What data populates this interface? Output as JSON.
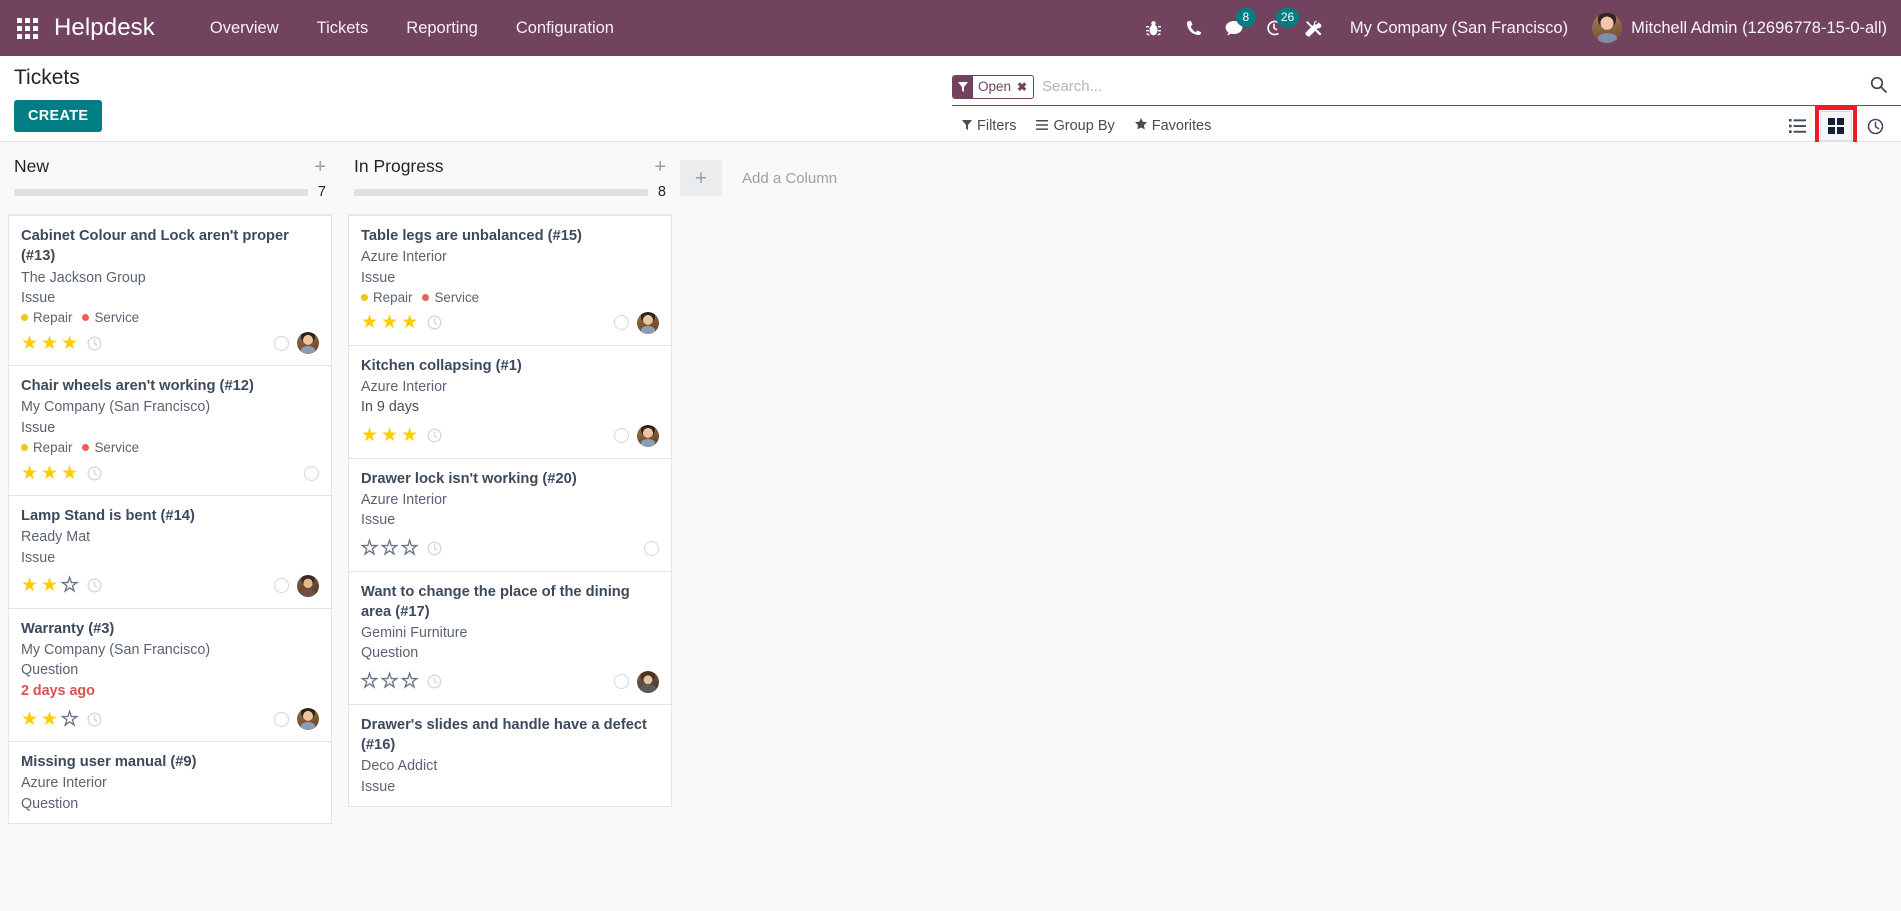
{
  "navbar": {
    "apps_icon": "apps-grid-icon",
    "brand": "Helpdesk",
    "menu": [
      {
        "label": "Overview"
      },
      {
        "label": "Tickets"
      },
      {
        "label": "Reporting"
      },
      {
        "label": "Configuration"
      }
    ],
    "sys_icons": [
      {
        "name": "bug-icon",
        "badge": ""
      },
      {
        "name": "phone-icon",
        "badge": ""
      },
      {
        "name": "messages-icon",
        "badge": "8"
      },
      {
        "name": "activities-clock-icon",
        "badge": "26"
      },
      {
        "name": "tools-icon",
        "badge": ""
      }
    ],
    "company": "My Company (San Francisco)",
    "user": "Mitchell Admin (12696778-15-0-all)"
  },
  "control_panel": {
    "page_title": "Tickets",
    "create_label": "CREATE",
    "search": {
      "facet_label": "Open",
      "facet_remove": "✖",
      "placeholder": "Search...",
      "value": ""
    },
    "filters_label": "Filters",
    "groupby_label": "Group By",
    "favorites_label": "Favorites",
    "views": [
      {
        "name": "list-view-button",
        "active": false
      },
      {
        "name": "kanban-view-button",
        "active": true
      },
      {
        "name": "activity-view-button",
        "active": false
      }
    ],
    "highlight_color": "#ed1c24"
  },
  "kanban": {
    "add_column_label": "Add a Column",
    "columns": [
      {
        "title": "New",
        "count": "7",
        "cards": [
          {
            "title": "Cabinet Colour and Lock aren't proper (#13)",
            "partner": "The Jackson Group",
            "type": "Issue",
            "date": "",
            "date_overdue": false,
            "tags": [
              {
                "label": "Repair",
                "color": "#f0c419"
              },
              {
                "label": "Service",
                "color": "#ee6055"
              }
            ],
            "stars": 3,
            "avatar": "av-mitchell"
          },
          {
            "title": "Chair wheels aren't working (#12)",
            "partner": "My Company (San Francisco)",
            "type": "Issue",
            "date": "",
            "date_overdue": false,
            "tags": [
              {
                "label": "Repair",
                "color": "#f0c419"
              },
              {
                "label": "Service",
                "color": "#ee6055"
              }
            ],
            "stars": 3,
            "avatar": ""
          },
          {
            "title": "Lamp Stand is bent (#14)",
            "partner": "Ready Mat",
            "type": "Issue",
            "date": "",
            "date_overdue": false,
            "tags": [],
            "stars": 2,
            "avatar": "av-marc"
          },
          {
            "title": "Warranty (#3)",
            "partner": "My Company (San Francisco)",
            "type": "Question",
            "date": "2 days ago",
            "date_overdue": true,
            "tags": [],
            "stars": 2,
            "avatar": "av-mitchell"
          },
          {
            "title": "Missing user manual (#9)",
            "partner": "Azure Interior",
            "type": "Question",
            "date": "",
            "date_overdue": false,
            "tags": [],
            "stars": 0,
            "avatar": ""
          }
        ]
      },
      {
        "title": "In Progress",
        "count": "8",
        "cards": [
          {
            "title": "Table legs are unbalanced (#15)",
            "partner": "Azure Interior",
            "type": "Issue",
            "date": "",
            "date_overdue": false,
            "tags": [
              {
                "label": "Repair",
                "color": "#f0c419"
              },
              {
                "label": "Service",
                "color": "#ee6055"
              }
            ],
            "stars": 3,
            "avatar": "av-mitchell"
          },
          {
            "title": "Kitchen collapsing (#1)",
            "partner": "Azure Interior",
            "type": "",
            "date": "In 9 days",
            "date_overdue": false,
            "tags": [],
            "stars": 3,
            "avatar": "av-mitchell"
          },
          {
            "title": "Drawer lock isn't working (#20)",
            "partner": "Azure Interior",
            "type": "Issue",
            "date": "",
            "date_overdue": false,
            "tags": [],
            "stars": 0,
            "avatar": ""
          },
          {
            "title": "Want to change the place of the dining area (#17)",
            "partner": "Gemini Furniture",
            "type": "Question",
            "date": "",
            "date_overdue": false,
            "tags": [],
            "stars": 0,
            "avatar": "av-abigail"
          },
          {
            "title": "Drawer's slides and handle have a defect (#16)",
            "partner": "Deco Addict",
            "type": "Issue",
            "date": "",
            "date_overdue": false,
            "tags": [],
            "stars": 0,
            "avatar": ""
          }
        ]
      }
    ]
  }
}
